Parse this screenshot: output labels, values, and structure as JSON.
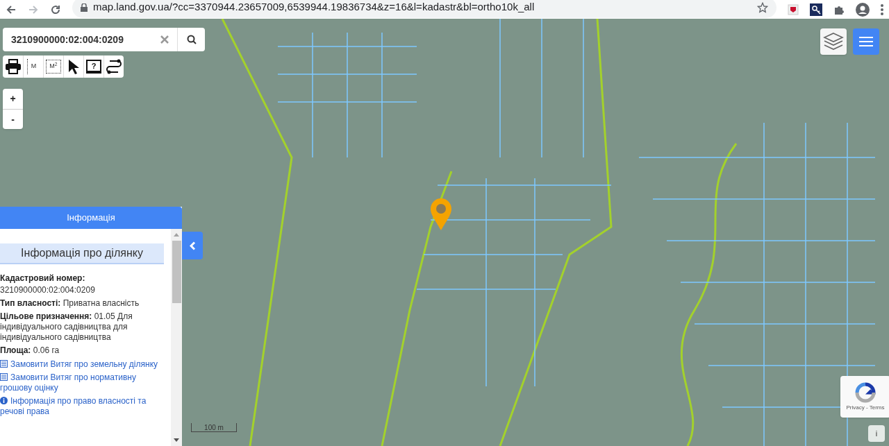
{
  "browser": {
    "url": "map.land.gov.ua/?cc=3370944.23657009,6539944.19836734&z=16&l=kadastr&bl=ortho10k_all"
  },
  "search": {
    "value": "3210900000:02:004:0209"
  },
  "tools": [
    {
      "kind": "print"
    },
    {
      "kind": "distance",
      "label": "M"
    },
    {
      "kind": "area",
      "label": "M$^{2}$"
    },
    {
      "kind": "pointer"
    },
    {
      "kind": "help",
      "label": "?"
    },
    {
      "kind": "route"
    }
  ],
  "zoom": [
    "+",
    "-"
  ],
  "info_panel": {
    "title": "Інформація",
    "section_title": "Інформація про ділянку",
    "fields": [
      {
        "label": "Кадастровий номер:",
        "value": "3210900000:02:004:0209",
        "kind": "block"
      },
      {
        "label": "Тип власності:",
        "value": "Приватна власність",
        "kind": "inline"
      },
      {
        "label": "Цільове призначення:",
        "value": "01.05 Для індивідуального садівництва для індивідуального садівництва",
        "kind": "inline"
      },
      {
        "label": "Площа:",
        "value": "0.06 га",
        "kind": "inline"
      }
    ],
    "links": [
      {
        "kind": "list",
        "text": "Замовити Витяг про земельну ділянку"
      },
      {
        "kind": "list",
        "text": "Замовити Витяг про нормативну грошову оцінку"
      },
      {
        "kind": "info",
        "text": "Інформація про право власності та речові права"
      }
    ]
  },
  "scale": "100 m",
  "recaptcha": "Privacy - Terms",
  "attribution": "i"
}
